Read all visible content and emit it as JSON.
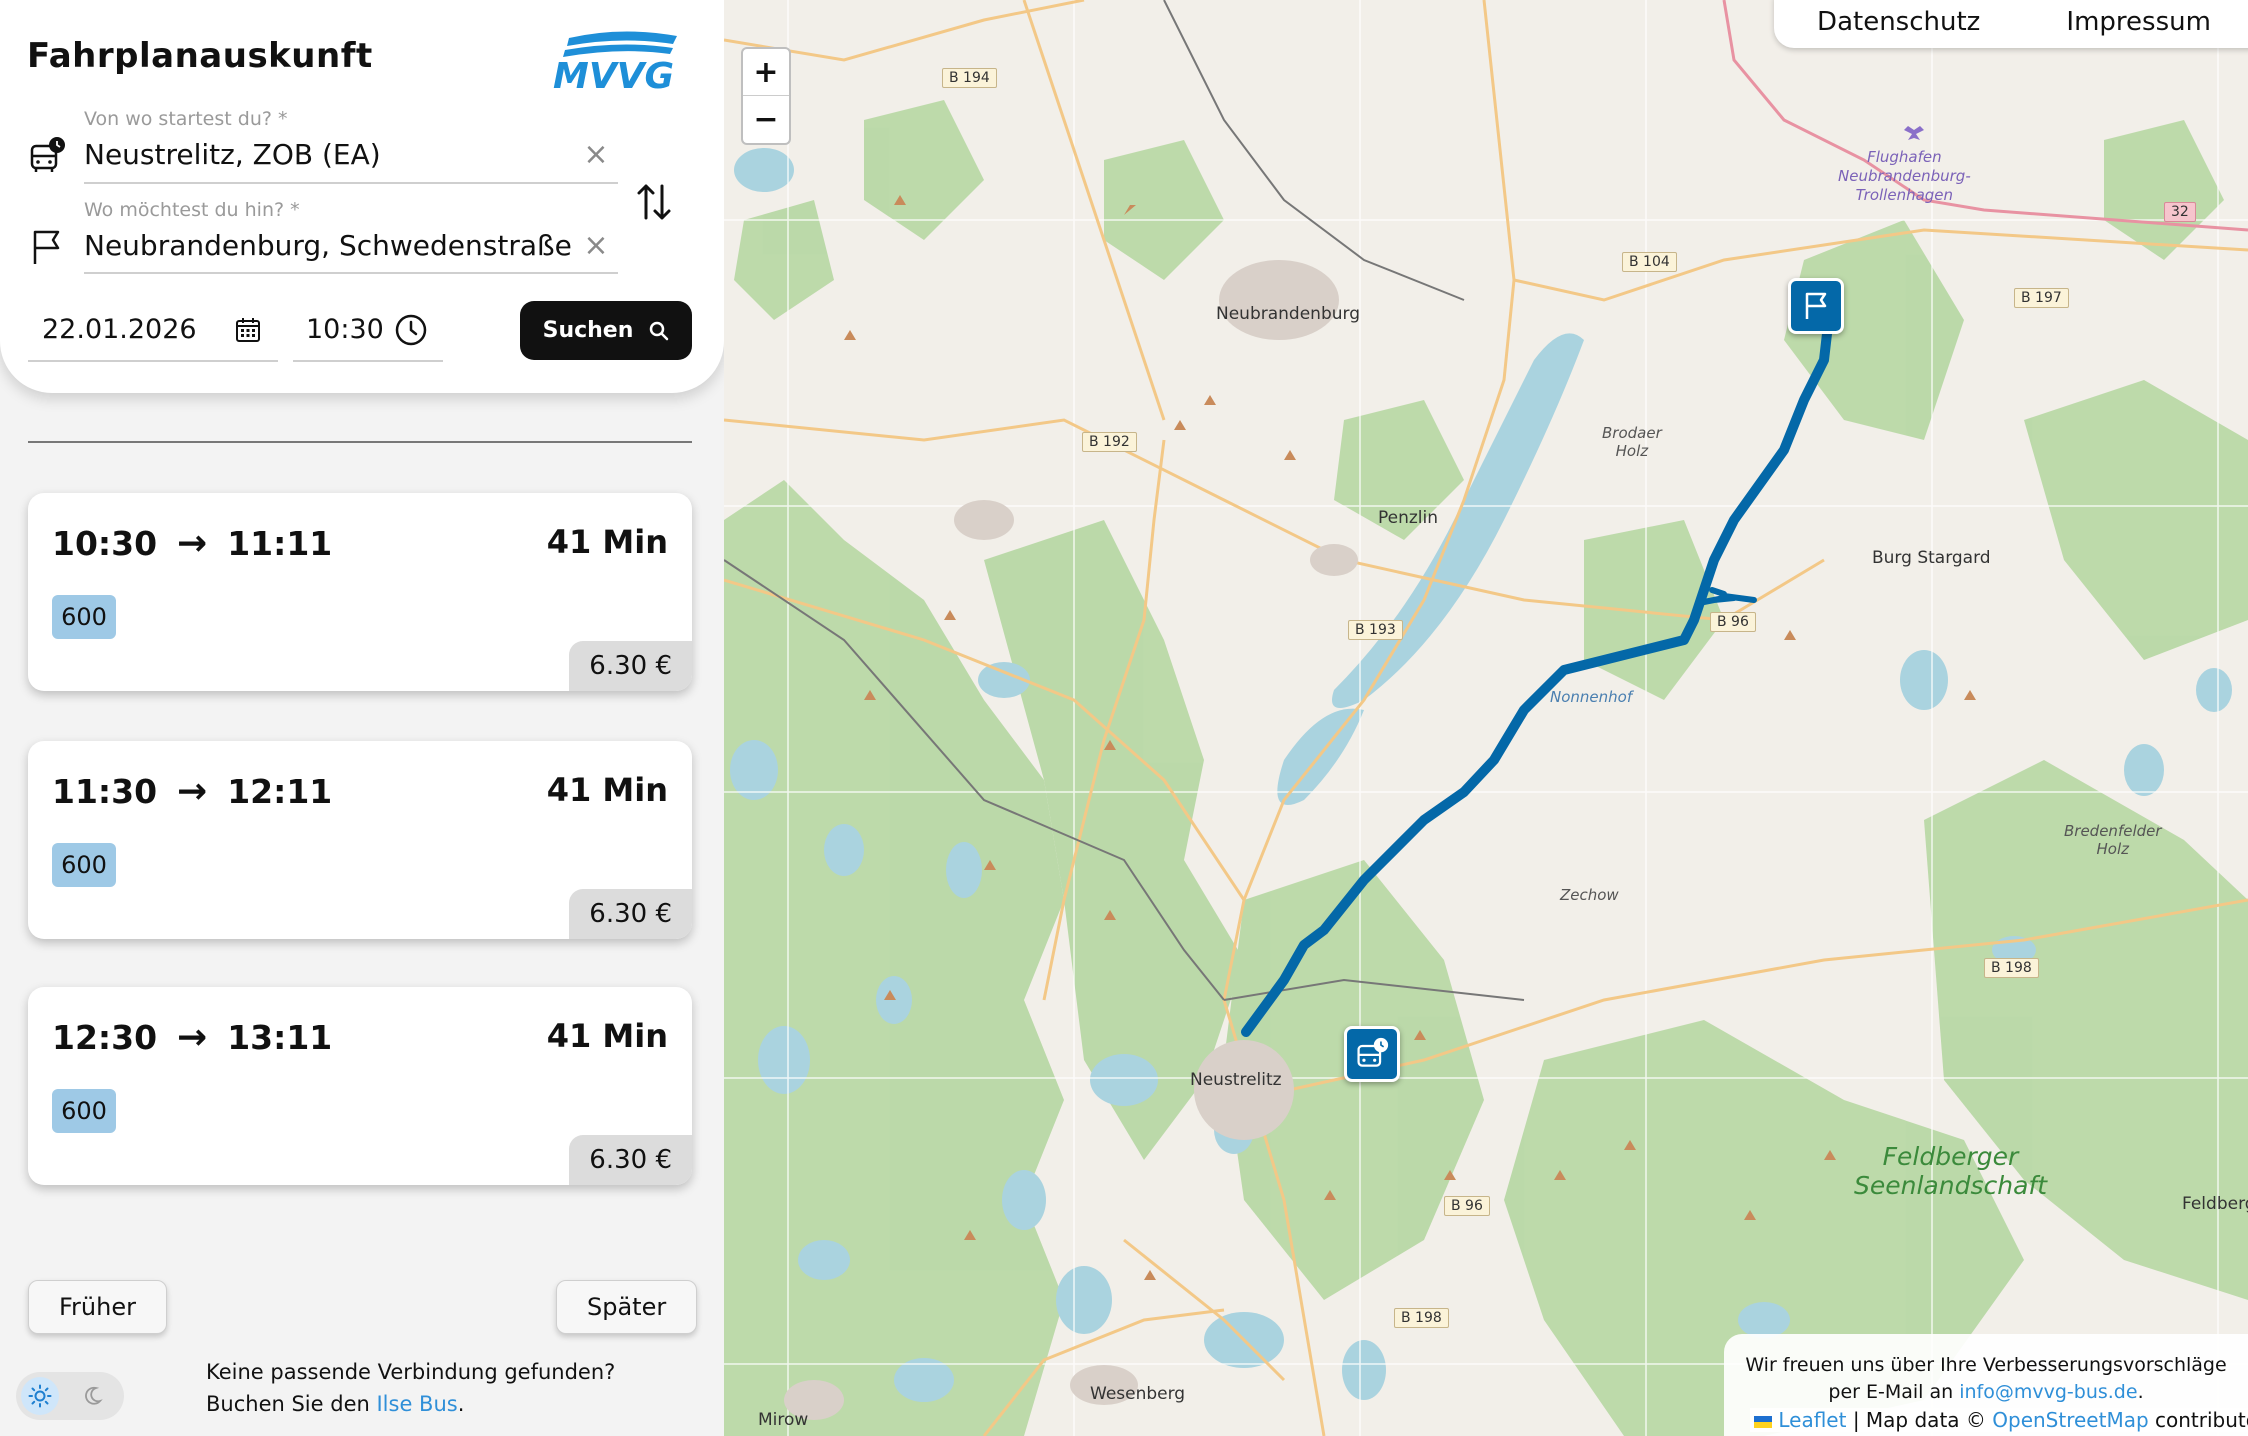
{
  "app": {
    "title": "Fahrplanauskunft",
    "logo_text": "MVVG"
  },
  "search": {
    "from_label": "Von wo startest du? *",
    "from_value": "Neustrelitz, ZOB (EA)",
    "to_label": "Wo möchtest du hin? *",
    "to_value": "Neubrandenburg, Schwedenstraße",
    "date": "22.01.2026",
    "time": "10:30",
    "search_button": "Suchen"
  },
  "results": [
    {
      "departure": "10:30",
      "arrival": "11:11",
      "duration": "41 Min",
      "line": "600",
      "price": "6.30 €"
    },
    {
      "departure": "11:30",
      "arrival": "12:11",
      "duration": "41 Min",
      "line": "600",
      "price": "6.30 €"
    },
    {
      "departure": "12:30",
      "arrival": "13:11",
      "duration": "41 Min",
      "line": "600",
      "price": "6.30 €"
    }
  ],
  "pagination": {
    "earlier": "Früher",
    "later": "Später"
  },
  "footer": {
    "line1": "Keine passende Verbindung gefunden?",
    "line2_prefix": "Buchen Sie den ",
    "line2_link": "Ilse Bus",
    "line2_suffix": "."
  },
  "map": {
    "zoom_in": "+",
    "zoom_out": "−",
    "legal": {
      "privacy": "Datenschutz",
      "imprint": "Impressum"
    },
    "feedback_line1": "Wir freuen uns über Ihre Verbesserungsvorschläge",
    "feedback_line2_prefix": "per E-Mail an ",
    "feedback_email": "info@mvvg-bus.de",
    "feedback_line2_suffix": ".",
    "attribution": {
      "leaflet": "Leaflet",
      "separator": " | Map data © ",
      "osm": "OpenStreetMap",
      "suffix": " contributors"
    },
    "places": {
      "neubrandenburg": "Neubrandenburg",
      "neustrelitz": "Neustrelitz",
      "penzlin": "Penzlin",
      "burg_stargard": "Burg Stargard",
      "wesenberg": "Wesenberg",
      "mirow": "Mirow",
      "feldberg": "Feldberg",
      "zechow": "Zechow",
      "nonnenhof": "Nonnenhof",
      "brodaer_holz": "Brodaer\nHolz",
      "bredenfelder_holz": "Bredenfelder\nHolz",
      "flughafen": "Flughafen\nNeubrandenburg-\nTrollenhagen",
      "feldberger_seenlandschaft": "Feldberger\nSeenlandschaft"
    },
    "roads": {
      "b194": "B 194",
      "b104": "B 104",
      "b197": "B 197",
      "b192": "B 192",
      "b193": "B 193",
      "b96_north": "B 96",
      "b198_east": "B 198",
      "b96_south": "B 96",
      "b198_south": "B 198",
      "r32": "32"
    },
    "colors": {
      "route": "#0468a8",
      "marker": "#0468a8",
      "forest": "#add19e",
      "water": "#aad3df"
    }
  }
}
